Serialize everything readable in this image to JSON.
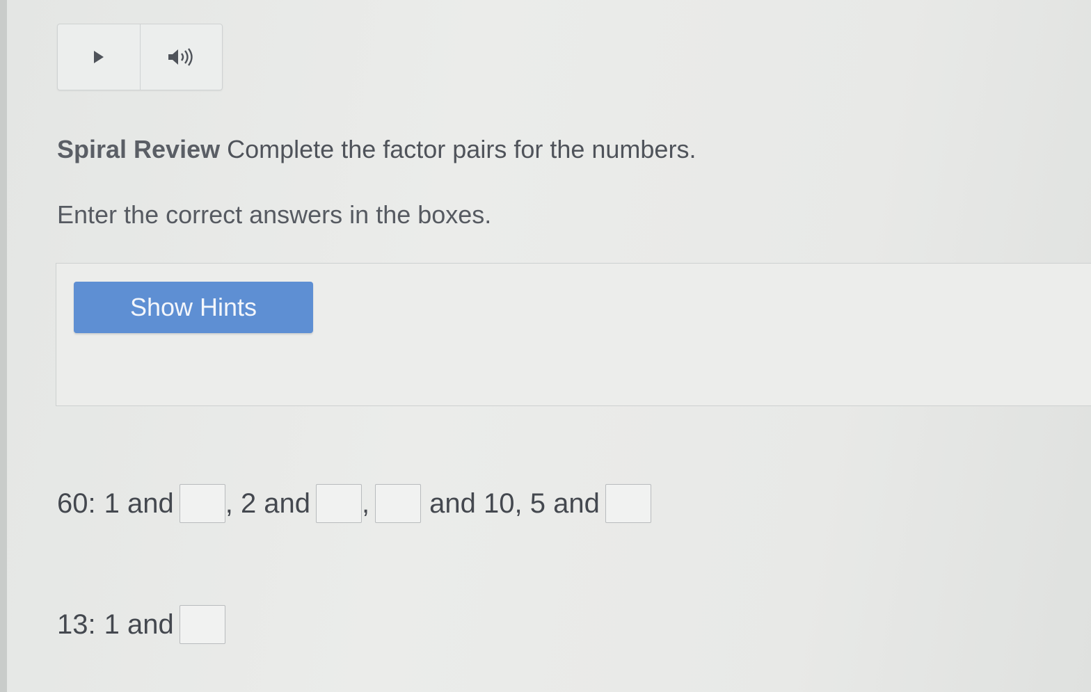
{
  "media": {
    "play_icon": "play-icon",
    "audio_icon": "speaker-icon"
  },
  "question": {
    "label": "Spiral Review",
    "prompt": "Complete the factor pairs for the numbers.",
    "instruction": "Enter the correct answers in the boxes."
  },
  "hints": {
    "button_label": "Show Hints"
  },
  "problems": {
    "p1": {
      "number": "60:",
      "t1": "1 and",
      "t2": ", 2 and",
      "t3": ",",
      "t4": "and 10, 5 and",
      "answers": [
        "",
        "",
        "",
        ""
      ]
    },
    "p2": {
      "number": "13:",
      "t1": "1 and",
      "answers": [
        ""
      ]
    }
  }
}
